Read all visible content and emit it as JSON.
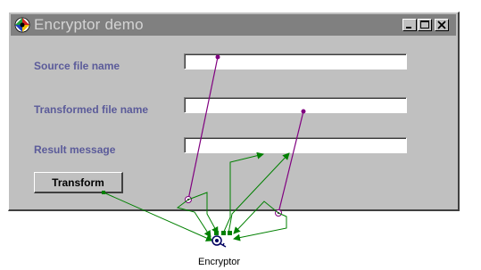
{
  "window": {
    "title": "Encryptor demo",
    "controls": {
      "minimize_icon": "minimize-icon",
      "maximize_icon": "maximize-icon",
      "close_icon": "close-icon"
    }
  },
  "form": {
    "source_label": "Source file name",
    "source_value": "",
    "transformed_label": "Transformed file name",
    "transformed_value": "",
    "result_label": "Result message",
    "result_value": "",
    "transform_button": "Transform"
  },
  "component": {
    "name": "Encryptor",
    "icon": "bean-icon"
  },
  "colors": {
    "window_bg": "#c0c0c0",
    "titlebar_bg": "#808080",
    "title_text": "#d4d4d4",
    "label_text": "#5b5b9a",
    "connection_purple": "#800080",
    "connection_green": "#008000"
  }
}
